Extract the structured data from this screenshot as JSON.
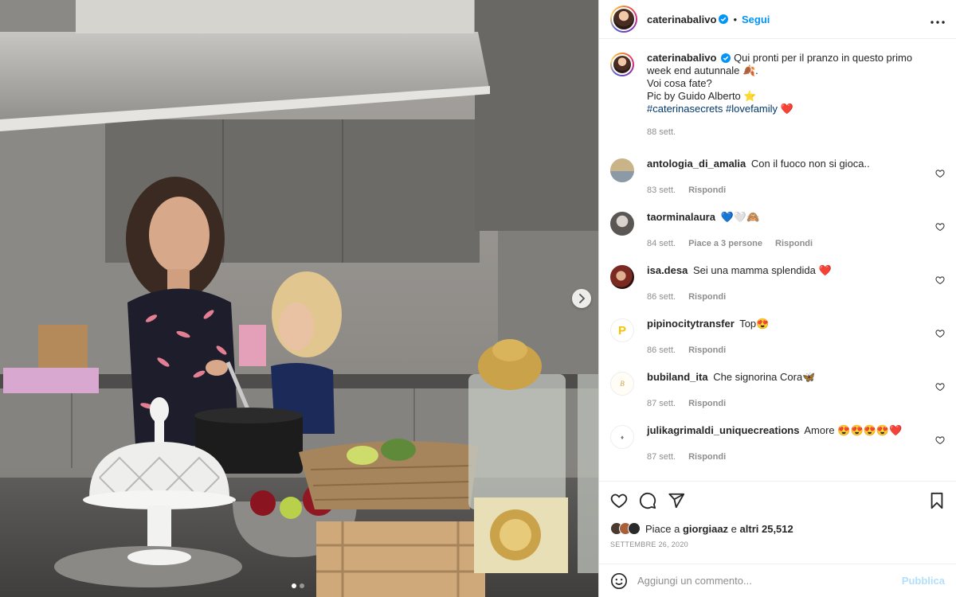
{
  "author": {
    "username": "caterinabalivo",
    "follow_label": "Segui",
    "verified_icon": "verified-badge-icon"
  },
  "caption": {
    "line1": "Qui pronti per il pranzo in questo primo week end autunnale 🍂.",
    "line2": "Voi cosa fate?",
    "line3": "Pic by Guido Alberto ⭐",
    "hashtag1": "#caterinasecrets",
    "hashtag2": "#lovefamily",
    "emoji_end": "❤️",
    "time": "88 sett."
  },
  "comments": [
    {
      "user": "antologia_di_amalia",
      "text": "Con il fuoco non si gioca..",
      "time": "83 sett.",
      "likes": "",
      "reply": "Rispondi",
      "avatar_color": "#c9b48a"
    },
    {
      "user": "taorminalaura",
      "text": "💙🤍🙈",
      "time": "84 sett.",
      "likes": "Piace a 3 persone",
      "reply": "Rispondi",
      "avatar_color": "#6b6b6b"
    },
    {
      "user": "isa.desa",
      "text": "Sei una mamma splendida ❤️",
      "time": "86 sett.",
      "likes": "",
      "reply": "Rispondi",
      "avatar_color": "#7a2a20"
    },
    {
      "user": "pipinocitytransfer",
      "text": "Top😍",
      "time": "86 sett.",
      "likes": "",
      "reply": "Rispondi",
      "avatar_color": "#f5c400"
    },
    {
      "user": "bubiland_ita",
      "text": "Che signorina Cora🦋",
      "time": "87 sett.",
      "likes": "",
      "reply": "Rispondi",
      "avatar_color": "#e8d9a0"
    },
    {
      "user": "julikagrimaldi_uniquecreations",
      "text": "Amore 😍😍😍😍❤️",
      "time": "87 sett.",
      "likes": "",
      "reply": "Rispondi",
      "avatar_color": "#d8d0bc"
    }
  ],
  "likes": {
    "prefix": "Piace a ",
    "user": "giorgiaaz",
    "joiner": " e ",
    "others": "altri 25,512"
  },
  "date": "SETTEMBRE 26, 2020",
  "add_comment": {
    "placeholder": "Aggiungi un commento...",
    "publish_label": "Pubblica"
  },
  "colors": {
    "accent": "#0095f6",
    "publish_disabled": "#b2dffc",
    "muted": "#8e8e8e",
    "heart_red": "#ed4956"
  },
  "carousel": {
    "current": 1,
    "total": 2
  }
}
